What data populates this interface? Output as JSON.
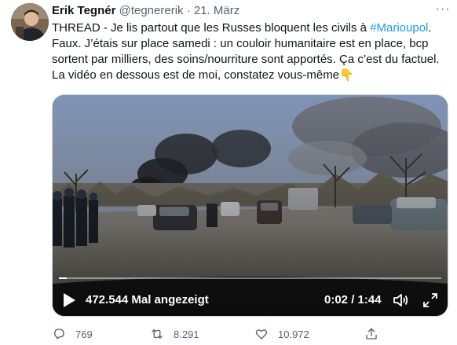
{
  "author": {
    "name": "Erik Tegnér",
    "handle": "@tegnererik",
    "separator": "·",
    "date": "21. März"
  },
  "tweet": {
    "text_before_hashtag": "THREAD - Je lis partout que les Russes bloquent les civils à ",
    "hashtag": "#Marioupol",
    "text_after_hashtag": ".",
    "line2": "Faux. J’étais sur place samedi : un couloir humanitaire est en place, bcp sortent par milliers, des soins/nourriture sont apportés. Ça c’est du factuel.",
    "line3": "La vidéo en dessous est de moi, constatez vous-même👇"
  },
  "video": {
    "views": "472.544 Mal angezeigt",
    "time": "0:02 / 1:44",
    "progress": 0.02
  },
  "actions": {
    "replies": "769",
    "retweets": "8.291",
    "likes": "10.972"
  },
  "colors": {
    "accent": "#1d9bf0",
    "secondary_text": "#536471"
  },
  "icons": [
    "more-icon",
    "play-icon",
    "volume-icon",
    "fullscreen-icon",
    "reply-icon",
    "retweet-icon",
    "like-icon",
    "share-icon"
  ]
}
